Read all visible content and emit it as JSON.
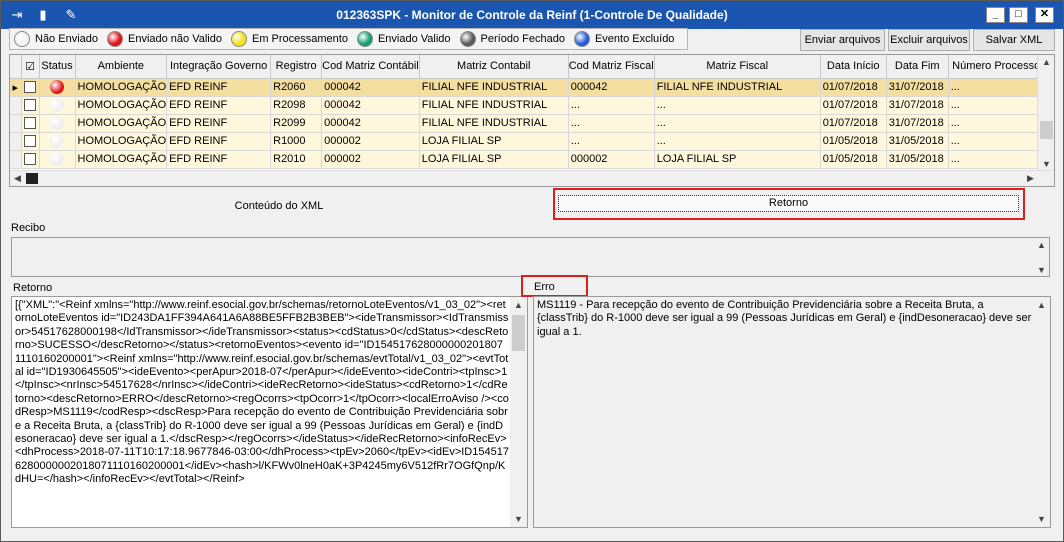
{
  "window": {
    "title": "012363SPK - Monitor de Controle da Reinf (1-Controle De Qualidade)",
    "minimize": "_",
    "maximize": "□",
    "close": "✕"
  },
  "legend": [
    {
      "label": "Não Enviado",
      "color": "#f2f2f2"
    },
    {
      "label": "Enviado não Valido",
      "color": "#e0141a"
    },
    {
      "label": "Em Processamento",
      "color": "#f5e21a"
    },
    {
      "label": "Enviado Valido",
      "color": "#13a36a"
    },
    {
      "label": "Período Fechado",
      "color": "#5a5a5a"
    },
    {
      "label": "Evento Excluído",
      "color": "#2a5bd8"
    }
  ],
  "toolbar": {
    "enviar": "Enviar arquivos",
    "excluir": "Excluir arquivos",
    "salvar": "Salvar XML"
  },
  "grid": {
    "columns": [
      "Status",
      "Ambiente",
      "Integração Governo",
      "Registro",
      "Cod Matriz Contábil",
      "Matriz Contabil",
      "Cod Matriz Fiscal",
      "Matriz Fiscal",
      "Data Início",
      "Data Fim",
      "Número Processo"
    ],
    "header_check": "☑",
    "rows": [
      {
        "status": "red",
        "ambiente": "HOMOLOGAÇÃO",
        "integracao": "EFD REINF",
        "registro": "R2060",
        "cod_contabil": "000042",
        "matriz_contabil": "FILIAL NFE INDUSTRIAL",
        "cod_fiscal": "000042",
        "matriz_fiscal": "FILIAL NFE INDUSTRIAL",
        "inicio": "01/07/2018",
        "fim": "31/07/2018",
        "processo": "..."
      },
      {
        "status": "white",
        "ambiente": "HOMOLOGAÇÃO",
        "integracao": "EFD REINF",
        "registro": "R2098",
        "cod_contabil": "000042",
        "matriz_contabil": "FILIAL NFE INDUSTRIAL",
        "cod_fiscal": "...",
        "matriz_fiscal": "...",
        "inicio": "01/07/2018",
        "fim": "31/07/2018",
        "processo": "..."
      },
      {
        "status": "white",
        "ambiente": "HOMOLOGAÇÃO",
        "integracao": "EFD REINF",
        "registro": "R2099",
        "cod_contabil": "000042",
        "matriz_contabil": "FILIAL NFE INDUSTRIAL",
        "cod_fiscal": "...",
        "matriz_fiscal": "...",
        "inicio": "01/07/2018",
        "fim": "31/07/2018",
        "processo": "..."
      },
      {
        "status": "white",
        "ambiente": "HOMOLOGAÇÃO",
        "integracao": "EFD REINF",
        "registro": "R1000",
        "cod_contabil": "000002",
        "matriz_contabil": "LOJA FILIAL SP",
        "cod_fiscal": "...",
        "matriz_fiscal": "...",
        "inicio": "01/05/2018",
        "fim": "31/05/2018",
        "processo": "..."
      },
      {
        "status": "white",
        "ambiente": "HOMOLOGAÇÃO",
        "integracao": "EFD REINF",
        "registro": "R2010",
        "cod_contabil": "000002",
        "matriz_contabil": "LOJA FILIAL SP",
        "cod_fiscal": "000002",
        "matriz_fiscal": "LOJA FILIAL SP",
        "inicio": "01/05/2018",
        "fim": "31/05/2018",
        "processo": "..."
      }
    ]
  },
  "tabs": {
    "xml": "Conteúdo do XML",
    "retorno": "Retorno"
  },
  "recibo": {
    "label": "Recibo",
    "value": ""
  },
  "retorno": {
    "label": "Retorno",
    "text": "[{\"XML\":\"<Reinf xmlns=\"http://www.reinf.esocial.gov.br/schemas/retornoLoteEventos/v1_03_02\"><retornoLoteEventos id=\"ID243DA1FF394A641A6A88BE5FFB2B3BEB\"><ideTransmissor><IdTransmissor>54517628000198</IdTransmissor></ideTransmissor><status><cdStatus>0</cdStatus><descRetorno>SUCESSO</descRetorno></status><retornoEventos><evento id=\"ID1545176280000002018071110160200001\"><Reinf xmlns=\"http://www.reinf.esocial.gov.br/schemas/evtTotal/v1_03_02\"><evtTotal id=\"ID1930645505\"><ideEvento><perApur>2018-07</perApur></ideEvento><ideContri><tpInsc>1</tpInsc><nrInsc>54517628</nrInsc></ideContri><ideRecRetorno><ideStatus><cdRetorno>1</cdRetorno><descRetorno>ERRO</descRetorno><regOcorrs><tpOcorr>1</tpOcorr><localErroAviso /><codResp>MS1119</codResp><dscResp>Para recepção do evento de Contribuição Previdenciária sobre a Receita Bruta, a {classTrib} do R-1000 deve ser igual a 99 (Pessoas Jurídicas em Geral) e {indDesoneracao} deve ser igual a 1.</dscResp></regOcorrs></ideStatus></ideRecRetorno><infoRecEv><dhProcess>2018-07-11T10:17:18.9677846-03:00</dhProcess><tpEv>2060</tpEv><idEv>ID1545176280000002018071110160200001</idEv><hash>l/KFWv0lneH0aK+3P4245my6V512fRr7OGfQnp/KdHU=</hash></infoRecEv></evtTotal></Reinf>"
  },
  "erro": {
    "label": "Erro",
    "text": "MS1119 - Para recepção do evento de Contribuição Previdenciária sobre a Receita Bruta, a {classTrib} do R-1000 deve ser igual a 99 (Pessoas Jurídicas em Geral) e {indDesoneracao} deve ser igual a 1."
  },
  "status_colors": {
    "red": "#e0141a",
    "white": "#eeeeee"
  }
}
